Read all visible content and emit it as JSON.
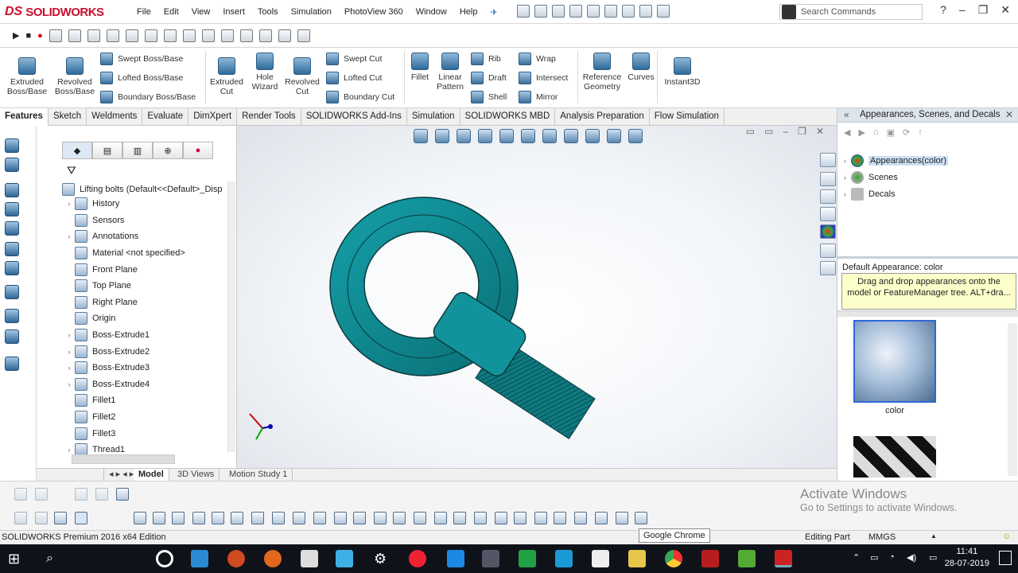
{
  "app": {
    "logo_text": "SOLIDWORKS",
    "edition_status": "SOLIDWORKS Premium 2016 x64 Edition"
  },
  "menu": {
    "items": [
      "File",
      "Edit",
      "View",
      "Insert",
      "Tools",
      "Simulation",
      "PhotoView 360",
      "Window",
      "Help"
    ],
    "search_placeholder": "Search Commands"
  },
  "command_manager": {
    "extruded_boss": "Extruded Boss/Base",
    "revolved_boss": "Revolved Boss/Base",
    "swept_boss": "Swept Boss/Base",
    "lofted_boss": "Lofted Boss/Base",
    "boundary_boss": "Boundary Boss/Base",
    "extruded_cut": "Extruded Cut",
    "hole_wizard": "Hole Wizard",
    "revolved_cut": "Revolved Cut",
    "swept_cut": "Swept Cut",
    "lofted_cut": "Lofted Cut",
    "boundary_cut": "Boundary Cut",
    "fillet": "Fillet",
    "linear_pattern": "Linear Pattern",
    "rib": "Rib",
    "draft": "Draft",
    "shell": "Shell",
    "wrap": "Wrap",
    "intersect": "Intersect",
    "mirror": "Mirror",
    "reference_geometry": "Reference Geometry",
    "curves": "Curves",
    "instant3d": "Instant3D"
  },
  "tabs": [
    "Features",
    "Sketch",
    "Weldments",
    "Evaluate",
    "DimXpert",
    "Render Tools",
    "SOLIDWORKS Add-Ins",
    "Simulation",
    "SOLIDWORKS MBD",
    "Analysis Preparation",
    "Flow Simulation"
  ],
  "feature_tree": {
    "root": "Lifting bolts  (Default<<Default>_Disp",
    "items": [
      {
        "label": "History",
        "arrow": "›"
      },
      {
        "label": "Sensors",
        "arrow": ""
      },
      {
        "label": "Annotations",
        "arrow": "›"
      },
      {
        "label": "Material <not specified>",
        "arrow": ""
      },
      {
        "label": "Front Plane",
        "arrow": ""
      },
      {
        "label": "Top Plane",
        "arrow": ""
      },
      {
        "label": "Right Plane",
        "arrow": ""
      },
      {
        "label": "Origin",
        "arrow": ""
      },
      {
        "label": "Boss-Extrude1",
        "arrow": "›"
      },
      {
        "label": "Boss-Extrude2",
        "arrow": "›"
      },
      {
        "label": "Boss-Extrude3",
        "arrow": "›"
      },
      {
        "label": "Boss-Extrude4",
        "arrow": "›"
      },
      {
        "label": "Fillet1",
        "arrow": ""
      },
      {
        "label": "Fillet2",
        "arrow": ""
      },
      {
        "label": "Fillet3",
        "arrow": ""
      },
      {
        "label": "Thread1",
        "arrow": "›"
      }
    ]
  },
  "viewport_tabs": [
    "Model",
    "3D Views",
    "Motion Study 1"
  ],
  "task_pane": {
    "title": "Appearances, Scenes, and Decals",
    "tree": [
      "Appearances(color)",
      "Scenes",
      "Decals"
    ],
    "default_appearance": "Default Appearance: color",
    "tooltip": "Drag and drop appearances onto the model or FeatureManager tree.  ALT+dra...",
    "swatch_label": "color"
  },
  "status": {
    "editing": "Editing Part",
    "units": "MMGS",
    "units_arrow": "▲"
  },
  "watermark": {
    "line1": "Activate Windows",
    "line2": "Go to Settings to activate Windows."
  },
  "taskbar": {
    "chrome_tip": "Google Chrome",
    "time": "11:41",
    "date": "28-07-2019"
  },
  "colors": {
    "part_teal": "#0b7f86",
    "accent_red": "#c8102e"
  }
}
